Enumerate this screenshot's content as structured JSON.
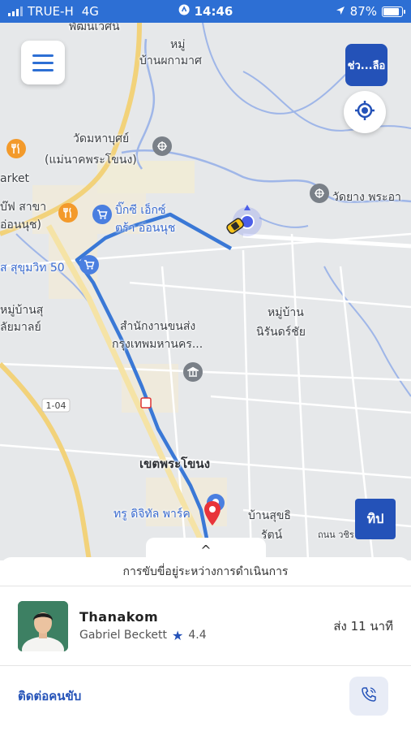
{
  "status_bar": {
    "carrier": "TRUE-H",
    "network": "4G",
    "time": "14:46",
    "battery": "87%",
    "battery_level": 0.87
  },
  "map": {
    "labels": {
      "top_area": "พัฒนเวศน์",
      "village_1": "หมู่",
      "village_1b": "บ้านผกามาศ",
      "temple_1": "วัดมหาบุศย์",
      "temple_1b": "(แม่นาคพระโขนง)",
      "market": "arket",
      "ptt_1": "บ๊ฟ สาขา",
      "ptt_1b": "อ่อนนุช)",
      "bigc_1": "บิ๊กซี เอ็กซ์",
      "bigc_1b": "ตร้า อ่อนนุช",
      "sukhumvit": "ส สุขุมวิท 50",
      "village_2": "หมู่บ้านสุ",
      "village_2b": "ลัยมาลย์",
      "office_1": "สำนักงานขนส่ง",
      "office_1b": "กรุงเทพมหานคร...",
      "village_3": "หมู่บ้าน",
      "village_3b": "นิรันดร์ชัย",
      "temple_2": "วัดยาง พระอา",
      "road_1": "1-04",
      "district": "เขตพระโขนง",
      "true_park": "ทรู ดิจิทัล พาร์ค",
      "village_4": "บ้านสุขธิ",
      "village_4b": "รัตน์",
      "road_2": "ถนน วชิร"
    },
    "help_label": "ช่ว...ลือ",
    "tip_label": "ทิป",
    "expand_label": "^",
    "route_color": "#3a78d6",
    "accent_color": "#2452b8"
  },
  "sheet": {
    "status_text": "การขับขี่อยู่ระหว่างการดำเนินการ",
    "driver_name": "Thanakom",
    "car_name": "Gabriel Beckett",
    "rating_icon": "star-icon",
    "rating": "4.4",
    "eta": "ส่ง 11 นาที",
    "contact_label": "ติดต่อคนขับ",
    "call_icon": "phone-icon"
  }
}
